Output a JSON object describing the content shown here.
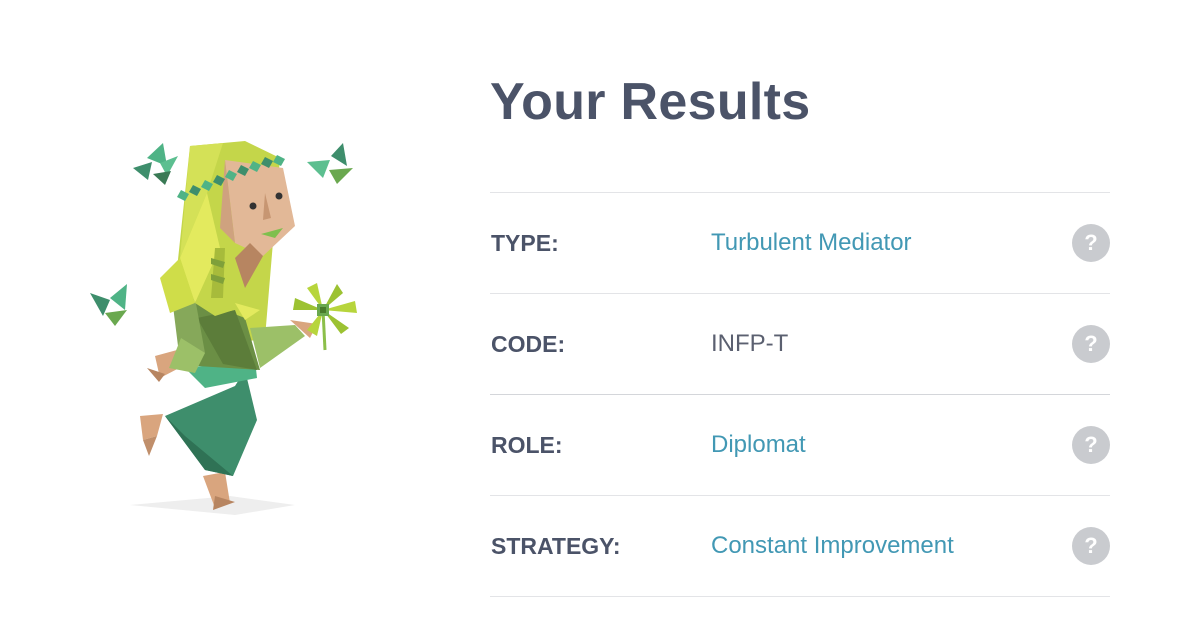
{
  "page": {
    "title": "Your Results"
  },
  "results": [
    {
      "label": "TYPE:",
      "value": "Turbulent Mediator",
      "style": "link"
    },
    {
      "label": "CODE:",
      "value": "INFP-T",
      "style": "plain"
    },
    {
      "label": "ROLE:",
      "value": "Diplomat",
      "style": "link"
    },
    {
      "label": "STRATEGY:",
      "value": "Constant Improvement",
      "style": "link"
    }
  ],
  "help_icon": {
    "glyph": "?",
    "icon": "question-mark-icon"
  },
  "illustration": {
    "subject": "mediator-character-illustration"
  },
  "colors": {
    "heading": "#4b5368",
    "link_value": "#4298b4",
    "plain_value": "#5b6070",
    "help_button": "#c9cbcf",
    "divider": "#e3e4e7",
    "hair": "#d4e157",
    "dress": "#3e8e6c",
    "leaf": "#6aa84f"
  }
}
